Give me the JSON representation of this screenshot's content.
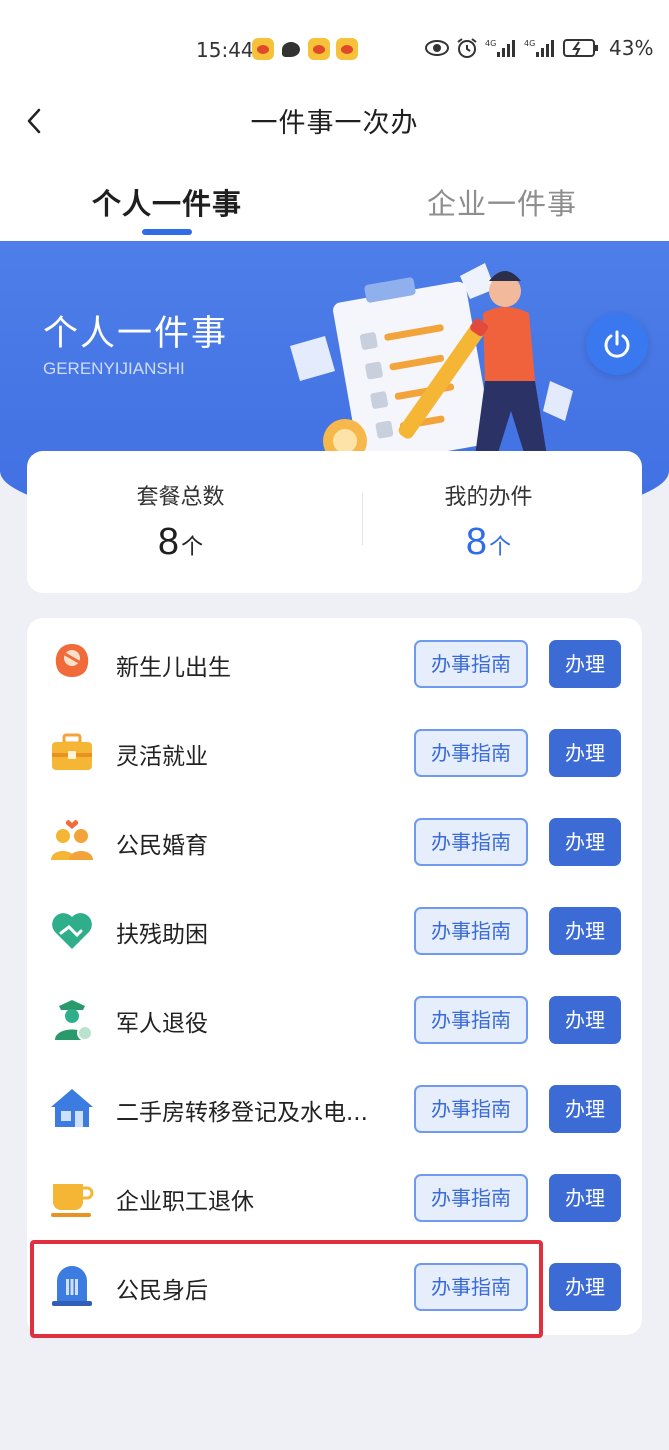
{
  "status_bar": {
    "time": "15:44",
    "battery": "43%",
    "notification_icons": [
      "weibo-icon",
      "chat-icon",
      "weibo-icon",
      "weibo-icon"
    ],
    "system_icons": [
      "eye-icon",
      "alarm-icon",
      "signal-4g-icon",
      "signal-4g-icon",
      "battery-icon"
    ]
  },
  "header": {
    "title": "一件事一次办",
    "back_icon": "chevron-left-icon"
  },
  "tabs": [
    {
      "label": "个人一件事",
      "active": true
    },
    {
      "label": "企业一件事",
      "active": false
    }
  ],
  "banner": {
    "title": "个人一件事",
    "subtitle": "GERENYIJIANSHI",
    "power_icon": "power-icon"
  },
  "stats": {
    "total": {
      "label": "套餐总数",
      "value": "8",
      "unit": "个"
    },
    "mine": {
      "label": "我的办件",
      "value": "8",
      "unit": "个"
    }
  },
  "items": [
    {
      "label": "新生儿出生",
      "icon": "newborn-icon",
      "guide_label": "办事指南",
      "handle_label": "办理"
    },
    {
      "label": "灵活就业",
      "icon": "briefcase-icon",
      "guide_label": "办事指南",
      "handle_label": "办理"
    },
    {
      "label": "公民婚育",
      "icon": "couple-icon",
      "guide_label": "办事指南",
      "handle_label": "办理"
    },
    {
      "label": "扶残助困",
      "icon": "handshake-heart-icon",
      "guide_label": "办事指南",
      "handle_label": "办理"
    },
    {
      "label": "军人退役",
      "icon": "soldier-icon",
      "guide_label": "办事指南",
      "handle_label": "办理"
    },
    {
      "label": "二手房转移登记及水电...",
      "icon": "house-icon",
      "guide_label": "办事指南",
      "handle_label": "办理"
    },
    {
      "label": "企业职工退休",
      "icon": "teacup-icon",
      "guide_label": "办事指南",
      "handle_label": "办理"
    },
    {
      "label": "公民身后",
      "icon": "memorial-icon",
      "guide_label": "办事指南",
      "handle_label": "办理"
    }
  ],
  "colors": {
    "accent": "#2f6ce8",
    "banner": "#4a7be6",
    "highlight": "#e0303f"
  }
}
